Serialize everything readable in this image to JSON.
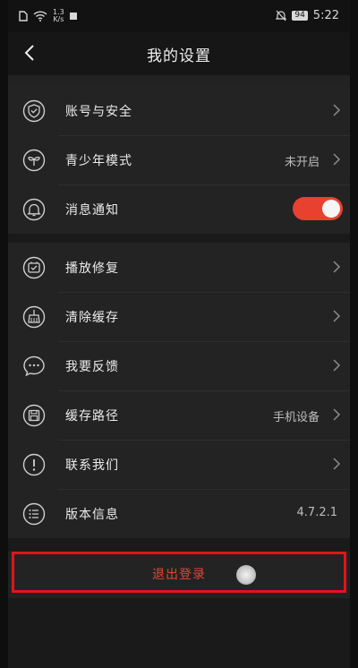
{
  "status_bar": {
    "speed_top": "1.3",
    "speed_bottom": "K/s",
    "battery": "94",
    "time": "5:22"
  },
  "header": {
    "title": "我的设置",
    "back_icon": "chevron-left-icon"
  },
  "section1": [
    {
      "label": "账号与安全",
      "value": "",
      "icon": "shield-icon",
      "arrow": true
    },
    {
      "label": "青少年模式",
      "value": "未开启",
      "icon": "sprout-icon",
      "arrow": true
    },
    {
      "label": "消息通知",
      "value": "",
      "icon": "bell-icon",
      "toggle": true,
      "toggle_on": true
    }
  ],
  "section2": [
    {
      "label": "播放修复",
      "value": "",
      "icon": "repair-icon",
      "arrow": true
    },
    {
      "label": "清除缓存",
      "value": "",
      "icon": "broom-icon",
      "arrow": true
    },
    {
      "label": "我要反馈",
      "value": "",
      "icon": "chat-bubble-icon",
      "arrow": true
    },
    {
      "label": "缓存路径",
      "value": "手机设备",
      "icon": "save-icon",
      "arrow": true
    },
    {
      "label": "联系我们",
      "value": "",
      "icon": "info-icon",
      "arrow": true
    },
    {
      "label": "版本信息",
      "value": "4.7.2.1",
      "icon": "list-icon",
      "arrow": false
    }
  ],
  "logout_label": "退出登录",
  "colors": {
    "accent": "#e8412f",
    "highlight_border": "#e0141b",
    "background": "#232323"
  }
}
